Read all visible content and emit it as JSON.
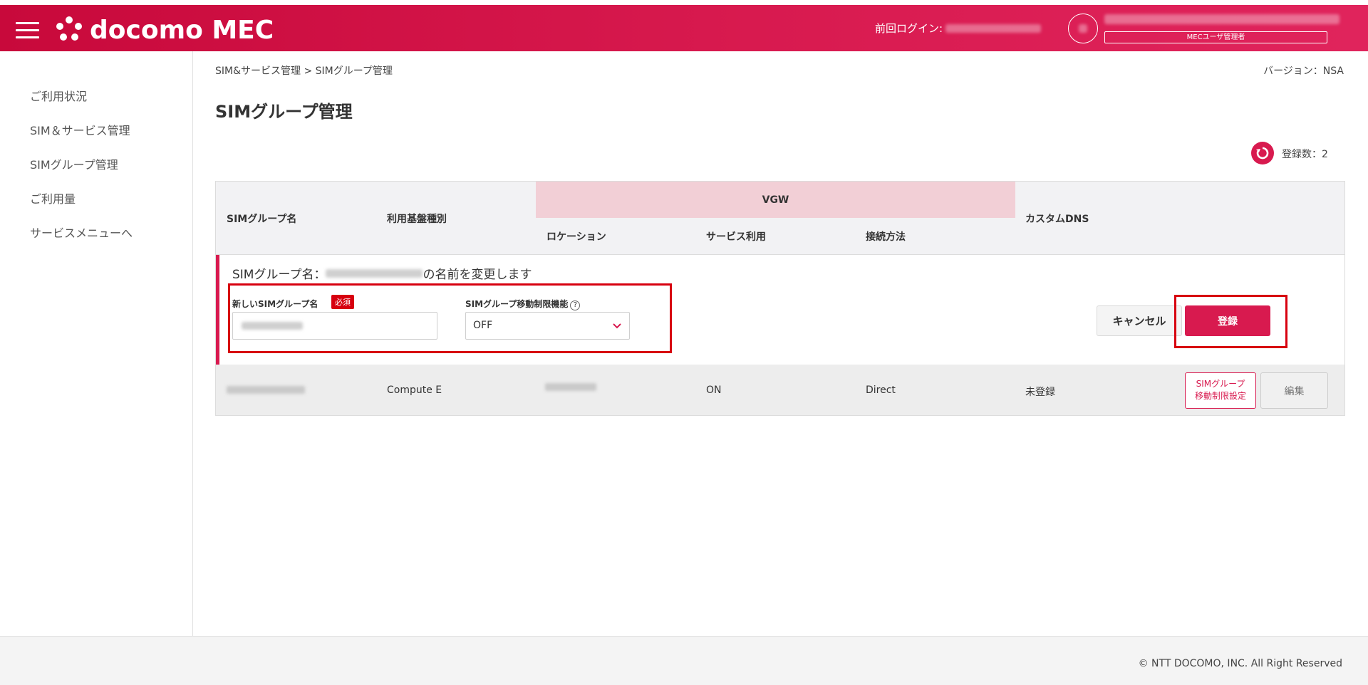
{
  "header": {
    "logo_text": "docomo MEC",
    "last_login_label": "前回ログイン:",
    "role_badge": "MECユーザ管理者"
  },
  "sidebar": {
    "items": [
      {
        "label": "ご利用状況"
      },
      {
        "label": "SIM＆サービス管理"
      },
      {
        "label": "SIMグループ管理"
      },
      {
        "label": "ご利用量"
      },
      {
        "label": "サービスメニューへ"
      }
    ]
  },
  "breadcrumb": "SIM&サービス管理 > SIMグループ管理",
  "version": "バージョン：NSA",
  "page_title": "SIMグループ管理",
  "registered_count": "登録数：2",
  "table": {
    "headers": {
      "sim_group_name": "SIMグループ名",
      "platform_type": "利用基盤種別",
      "vgw": "VGW",
      "location": "ロケーション",
      "service_use": "サービス利用",
      "connection_method": "接続方法",
      "custom_dns": "カスタムDNS"
    },
    "edit_form": {
      "title_prefix": "SIMグループ名：",
      "title_suffix": "の名前を変更します",
      "new_name_label": "新しいSIMグループ名",
      "required_badge": "必須",
      "restriction_label": "SIMグループ移動制限機能",
      "restriction_help": "?",
      "restriction_value": "OFF",
      "cancel_label": "キャンセル",
      "register_label": "登録"
    },
    "rows": [
      {
        "platform_type": "Compute E",
        "service_use": "ON",
        "connection_method": "Direct",
        "custom_dns": "未登録",
        "move_restriction_button": "SIMグループ\n移動制限設定",
        "edit_button": "編集"
      }
    ]
  },
  "footer": {
    "copyright": "© NTT DOCOMO, INC. All Right Reserved"
  },
  "colors": {
    "brand": "#d81a4f",
    "highlight_frame": "#d7000f",
    "vgw_band": "#f2cfd6"
  }
}
